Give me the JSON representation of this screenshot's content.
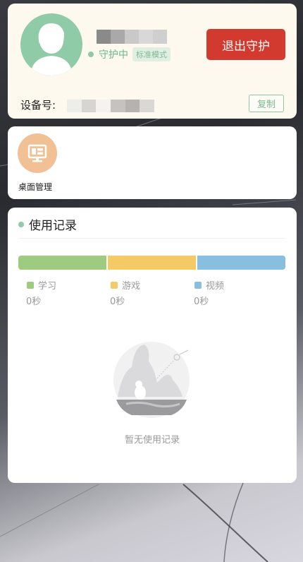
{
  "profile": {
    "status_text": "守护中",
    "mode_badge": "标准模式",
    "exit_button": "退出守护",
    "device_label": "设备号:",
    "copy_button": "复制"
  },
  "desktop": {
    "label": "桌面管理"
  },
  "usage": {
    "title": "使用记录",
    "categories": [
      {
        "name": "学习",
        "value": "0秒",
        "color": "#9ecb7f"
      },
      {
        "name": "游戏",
        "value": "0秒",
        "color": "#f4ca67"
      },
      {
        "name": "视频",
        "value": "0秒",
        "color": "#88bfdf"
      }
    ],
    "empty_text": "暂无使用记录"
  },
  "colors": {
    "accent_green": "#8ecba6",
    "exit_red": "#d23a30",
    "desktop_orange": "#f1c094"
  }
}
